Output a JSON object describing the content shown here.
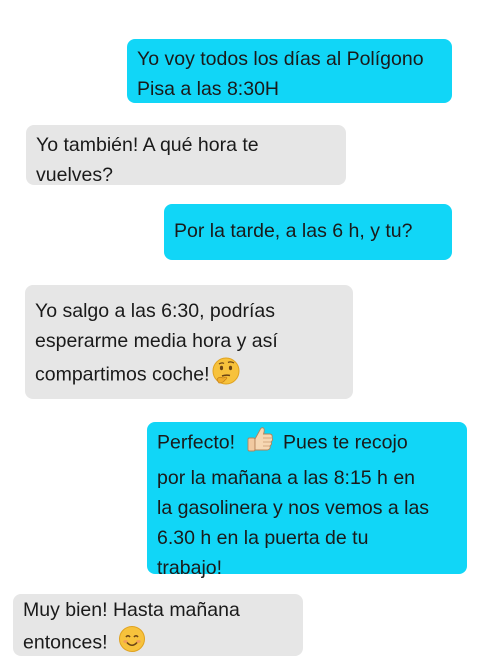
{
  "messages": [
    {
      "side": "sent",
      "lines": [
        "Yo voy todos los días al Polígono",
        "Pisa a las 8:30H"
      ]
    },
    {
      "side": "received",
      "lines": [
        "Yo también! A qué hora te",
        "vuelves?"
      ]
    },
    {
      "side": "sent",
      "lines": [
        "Por la tarde, a las 6 h, y tu?"
      ]
    },
    {
      "side": "received",
      "lines": [
        "Yo salgo a las 6:30, podrías",
        "esperarme media hora y así",
        "compartimos coche!"
      ],
      "emoji": "thinking-face-icon"
    },
    {
      "side": "sent",
      "lines": [
        "Perfecto!",
        "Pues te recojo",
        "por la mañana a las 8:15 h en",
        "la gasolinera y nos vemos a las",
        "6.30 h en la puerta de tu",
        "trabajo!"
      ],
      "emoji": "thumbs-up-icon"
    },
    {
      "side": "received",
      "lines": [
        "Muy bien! Hasta mañana",
        "entonces!"
      ],
      "emoji": "smiling-face-icon"
    }
  ],
  "colors": {
    "sent_bubble": "#11d6f7",
    "received_bubble": "#e6e6e6"
  }
}
